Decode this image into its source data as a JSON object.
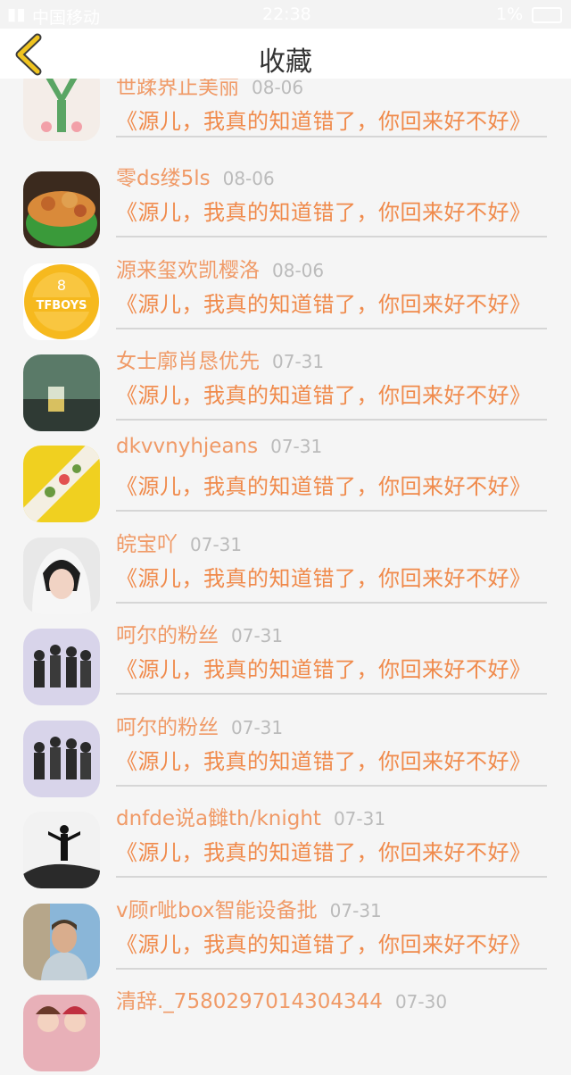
{
  "status_bar": {
    "carrier": "中国移动",
    "time": "22:38",
    "battery": "1%"
  },
  "header": {
    "title": "收藏"
  },
  "colors": {
    "name": "#f09a67",
    "title": "#f08a4b",
    "date": "#bbbbbb",
    "back_icon": "#f0c420"
  },
  "items": [
    {
      "name": "世蹂界止美丽",
      "date": "08-06",
      "title": "《源儿，我真的知道错了，你回来好不好》",
      "avatar": "peach-cartoon"
    },
    {
      "name": "零ds缕5ls",
      "date": "08-06",
      "title": "《源儿，我真的知道错了，你回来好不好》",
      "avatar": "food-bowl"
    },
    {
      "name": "源来玺欢凯樱洛",
      "date": "08-06",
      "title": "《源儿，我真的知道错了，你回来好不好》",
      "avatar": "tfboys-badge"
    },
    {
      "name": "女士廓肖恳优先",
      "date": "07-31",
      "title": "《源儿，我真的知道错了，你回来好不好》",
      "avatar": "glass-table"
    },
    {
      "name": "dkvvnyhjeans",
      "date": "07-31",
      "title": "《源儿，我真的知道错了，你回来好不好》",
      "avatar": "taco-food"
    },
    {
      "name": "皖宝吖",
      "date": "07-31",
      "title": "《源儿，我真的知道错了，你回来好不好》",
      "avatar": "portrait-hood"
    },
    {
      "name": "呵尔的粉丝",
      "date": "07-31",
      "title": "《源儿，我真的知道错了，你回来好不好》",
      "avatar": "group-photo"
    },
    {
      "name": "呵尔的粉丝",
      "date": "07-31",
      "title": "《源儿，我真的知道错了，你回来好不好》",
      "avatar": "group-photo"
    },
    {
      "name": "dnfde说a雠th/knight",
      "date": "07-31",
      "title": "《源儿，我真的知道错了，你回来好不好》",
      "avatar": "silhouette-rock"
    },
    {
      "name": "v顾r呲box智能设备批",
      "date": "07-31",
      "title": "《源儿，我真的知道错了，你回来好不好》",
      "avatar": "man-portrait"
    },
    {
      "name": "清辞._7580297014304344",
      "date": "07-30",
      "title": "",
      "avatar": "couple-photo"
    }
  ]
}
